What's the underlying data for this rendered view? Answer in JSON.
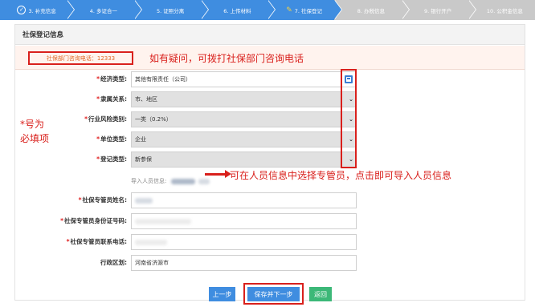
{
  "steps": [
    {
      "label": "3. 补充信息",
      "icon": "check-circle-icon"
    },
    {
      "label": "4. 多证合一"
    },
    {
      "label": "5. 证照分离"
    },
    {
      "label": "6. 上传材料"
    },
    {
      "label": "7. 社保登记",
      "icon": "pen-icon"
    },
    {
      "label": "8. 办税信息"
    },
    {
      "label": "9. 银行开户"
    },
    {
      "label": "10. 公积金信息"
    }
  ],
  "panel": {
    "title": "社保登记信息",
    "notice_label": "社保部门咨询电话：12333",
    "notice_annotation": "如有疑问，可拨打社保部门咨询电话"
  },
  "form": {
    "economic_type": {
      "label": "经济类型:",
      "value": "其他有限责任（公司）"
    },
    "affiliation": {
      "label": "隶属关系:",
      "value": "市、地区"
    },
    "industry_risk": {
      "label": "行业风险类别:",
      "value": "一类（0.2%）"
    },
    "unit_type": {
      "label": "单位类型:",
      "value": "企业"
    },
    "registration_type": {
      "label": "登记类型:",
      "value": "新参保"
    },
    "import_label": "导入人员信息:",
    "manager_name": {
      "label": "社保专管员姓名:"
    },
    "manager_id": {
      "label": "社保专管员身份证号码:"
    },
    "manager_phone": {
      "label": "社保专管员联系电话:"
    },
    "district": {
      "label": "行政区划:",
      "value": "河南省济源市"
    },
    "star": "*"
  },
  "annotations": {
    "required_line1": "*号为",
    "required_line2": "必填项",
    "import_hint": "可在人员信息中选择专管员，点击即可导入人员信息"
  },
  "buttons": {
    "prev": "上一步",
    "save_next": "保存并下一步",
    "back": "返回"
  },
  "colors": {
    "step_active": "#3f8de0",
    "step_todo": "#c9c9c9",
    "annotation_red": "#d9201c",
    "back_green": "#3cb878"
  }
}
